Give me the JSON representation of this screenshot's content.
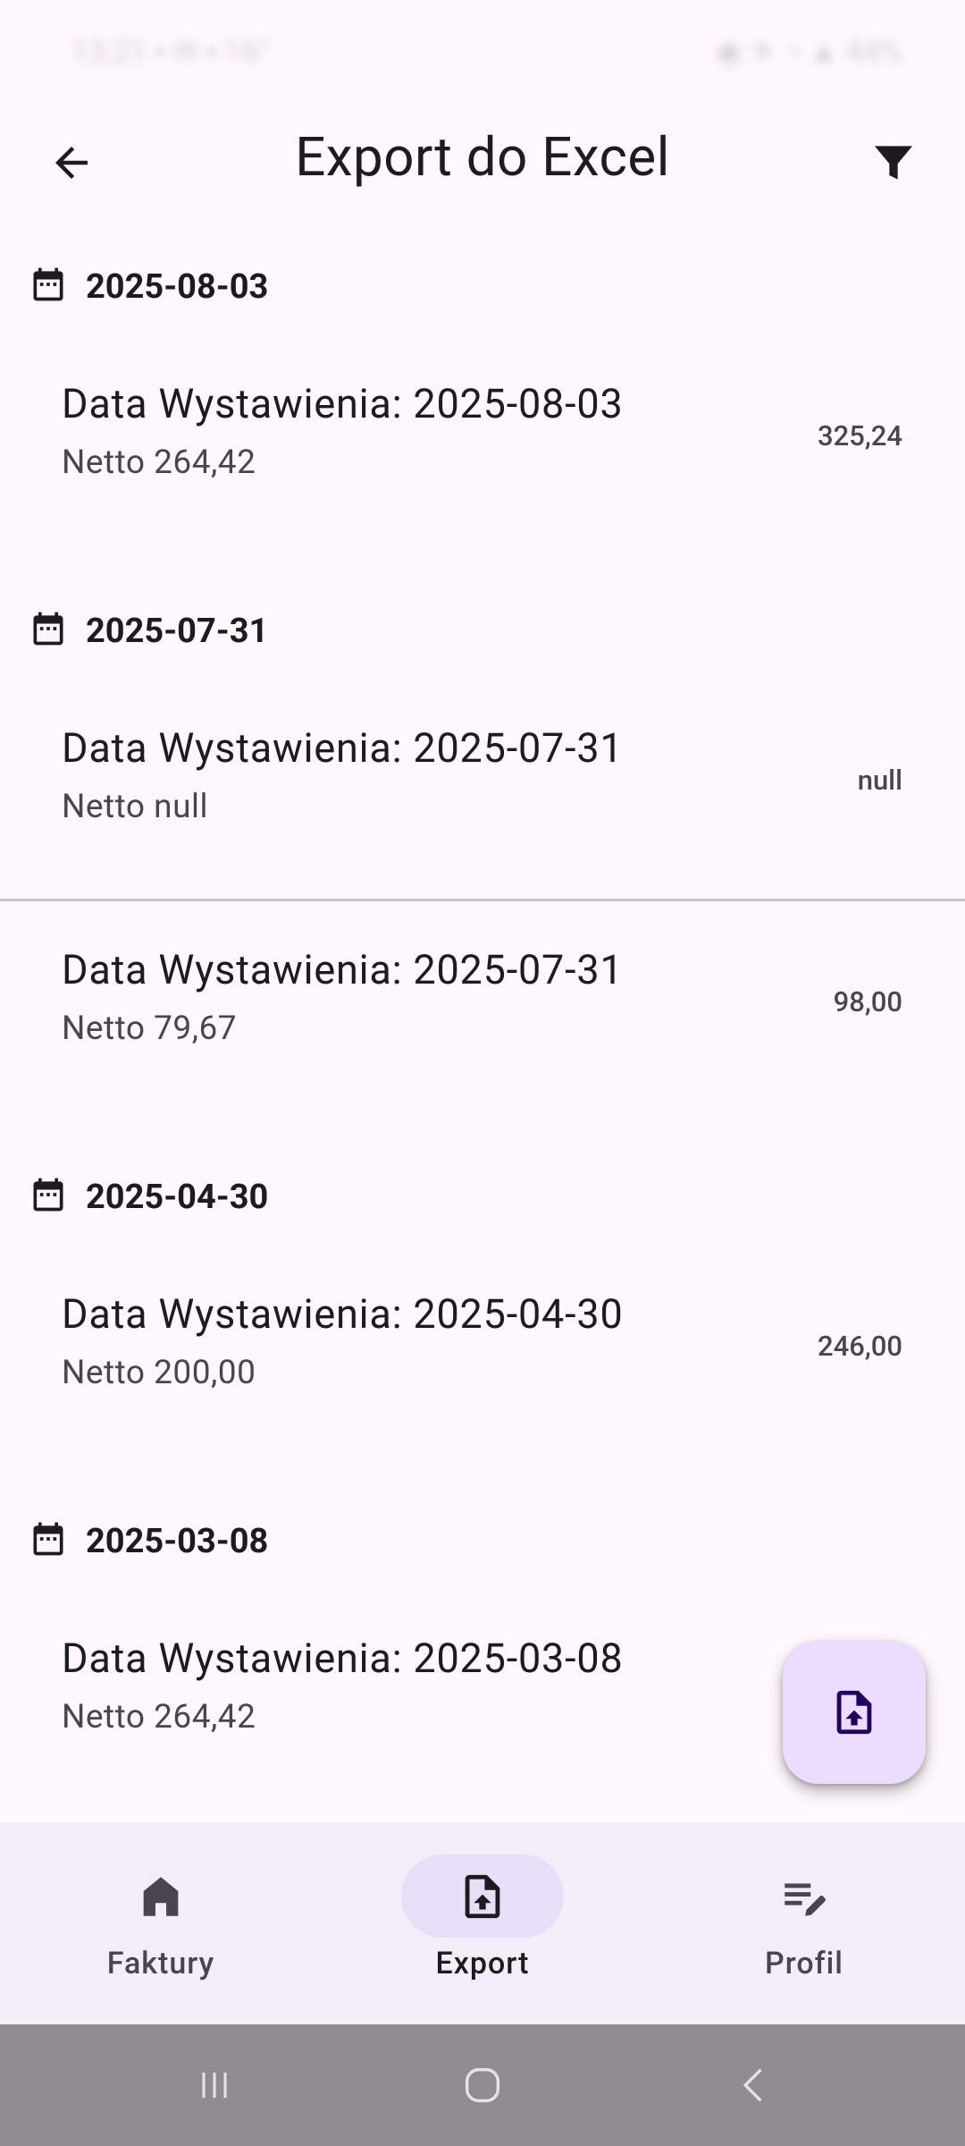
{
  "status_bar": {
    "time": "13:21",
    "left_extra": "▪ ✉ ▪ 16°",
    "right_text": "◉ ✈ ◔ ▲ 44%"
  },
  "app_bar": {
    "title": "Export do Excel"
  },
  "groups": [
    {
      "date": "2025-08-03",
      "items": [
        {
          "title": "Data Wystawienia: 2025-08-03",
          "subtitle": "Netto 264,42",
          "amount": "325,24"
        }
      ]
    },
    {
      "date": "2025-07-31",
      "items": [
        {
          "title": "Data Wystawienia: 2025-07-31",
          "subtitle": "Netto null",
          "amount": "null"
        },
        {
          "title": "Data Wystawienia: 2025-07-31",
          "subtitle": "Netto 79,67",
          "amount": "98,00"
        }
      ]
    },
    {
      "date": "2025-04-30",
      "items": [
        {
          "title": "Data Wystawienia: 2025-04-30",
          "subtitle": "Netto 200,00",
          "amount": "246,00"
        }
      ]
    },
    {
      "date": "2025-03-08",
      "items": [
        {
          "title": "Data Wystawienia: 2025-03-08",
          "subtitle": "Netto 264,42",
          "amount": ""
        }
      ]
    }
  ],
  "bottom_nav": {
    "items": [
      {
        "label": "Faktury",
        "icon": "home-icon"
      },
      {
        "label": "Export",
        "icon": "file-upload-icon",
        "active": true
      },
      {
        "label": "Profil",
        "icon": "edit-note-icon"
      }
    ]
  },
  "colors": {
    "background": "#fef7fc",
    "accent_container": "#eaddff",
    "nav_active_pill": "#e8def8",
    "nav_background": "#f3edf7",
    "icon_dark": "#21005d",
    "system_nav": "#8f8b90"
  }
}
